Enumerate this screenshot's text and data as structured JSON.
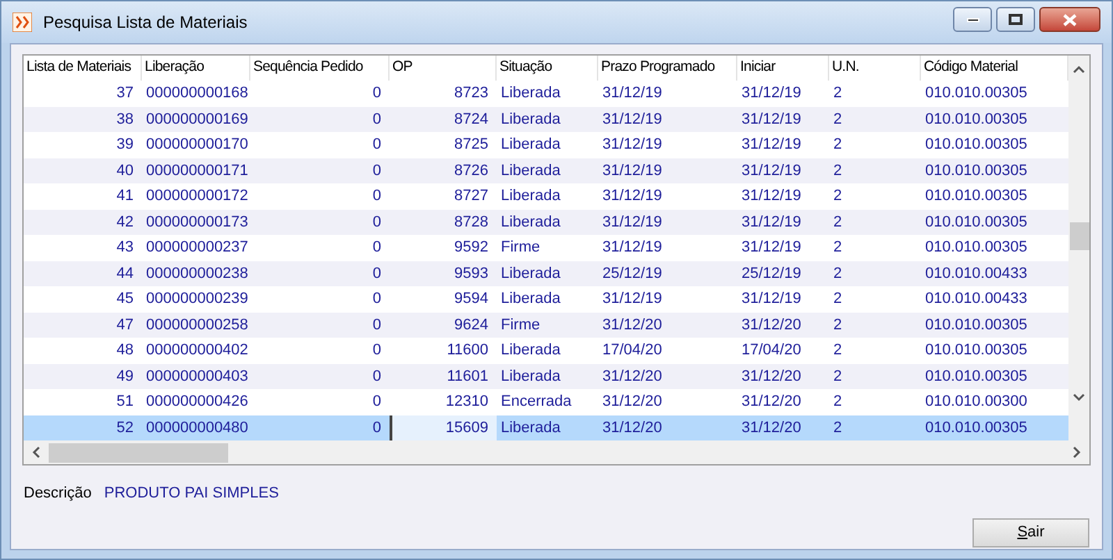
{
  "window": {
    "title": "Pesquisa Lista de Materiais"
  },
  "table": {
    "columns": [
      "Lista de Materiais",
      "Liberação",
      "Sequência Pedido",
      "OP",
      "Situação",
      "Prazo Programado",
      "Iniciar",
      "U.N.",
      "Código Material"
    ],
    "rows": [
      {
        "cells": [
          "37",
          "000000000168",
          "0",
          "8723",
          "Liberada",
          "31/12/19",
          "31/12/19",
          "2",
          "010.010.00305"
        ],
        "selected": false
      },
      {
        "cells": [
          "38",
          "000000000169",
          "0",
          "8724",
          "Liberada",
          "31/12/19",
          "31/12/19",
          "2",
          "010.010.00305"
        ],
        "selected": false
      },
      {
        "cells": [
          "39",
          "000000000170",
          "0",
          "8725",
          "Liberada",
          "31/12/19",
          "31/12/19",
          "2",
          "010.010.00305"
        ],
        "selected": false
      },
      {
        "cells": [
          "40",
          "000000000171",
          "0",
          "8726",
          "Liberada",
          "31/12/19",
          "31/12/19",
          "2",
          "010.010.00305"
        ],
        "selected": false
      },
      {
        "cells": [
          "41",
          "000000000172",
          "0",
          "8727",
          "Liberada",
          "31/12/19",
          "31/12/19",
          "2",
          "010.010.00305"
        ],
        "selected": false
      },
      {
        "cells": [
          "42",
          "000000000173",
          "0",
          "8728",
          "Liberada",
          "31/12/19",
          "31/12/19",
          "2",
          "010.010.00305"
        ],
        "selected": false
      },
      {
        "cells": [
          "43",
          "000000000237",
          "0",
          "9592",
          "Firme",
          "31/12/19",
          "31/12/19",
          "2",
          "010.010.00305"
        ],
        "selected": false
      },
      {
        "cells": [
          "44",
          "000000000238",
          "0",
          "9593",
          "Liberada",
          "25/12/19",
          "25/12/19",
          "2",
          "010.010.00433"
        ],
        "selected": false
      },
      {
        "cells": [
          "45",
          "000000000239",
          "0",
          "9594",
          "Liberada",
          "31/12/19",
          "31/12/19",
          "2",
          "010.010.00433"
        ],
        "selected": false
      },
      {
        "cells": [
          "47",
          "000000000258",
          "0",
          "9624",
          "Firme",
          "31/12/20",
          "31/12/20",
          "2",
          "010.010.00305"
        ],
        "selected": false
      },
      {
        "cells": [
          "48",
          "000000000402",
          "0",
          "11600",
          "Liberada",
          "17/04/20",
          "17/04/20",
          "2",
          "010.010.00305"
        ],
        "selected": false
      },
      {
        "cells": [
          "49",
          "000000000403",
          "0",
          "11601",
          "Liberada",
          "31/12/20",
          "31/12/20",
          "2",
          "010.010.00305"
        ],
        "selected": false
      },
      {
        "cells": [
          "51",
          "000000000426",
          "0",
          "12310",
          "Encerrada",
          "31/12/20",
          "31/12/20",
          "2",
          "010.010.00300"
        ],
        "selected": false
      },
      {
        "cells": [
          "52",
          "000000000480",
          "0",
          "15609",
          "Liberada",
          "31/12/20",
          "31/12/20",
          "2",
          "010.010.00305"
        ],
        "selected": true
      }
    ]
  },
  "description": {
    "label": "Descrição",
    "value": "PRODUTO PAI SIMPLES"
  },
  "buttons": [
    "Sair"
  ]
}
